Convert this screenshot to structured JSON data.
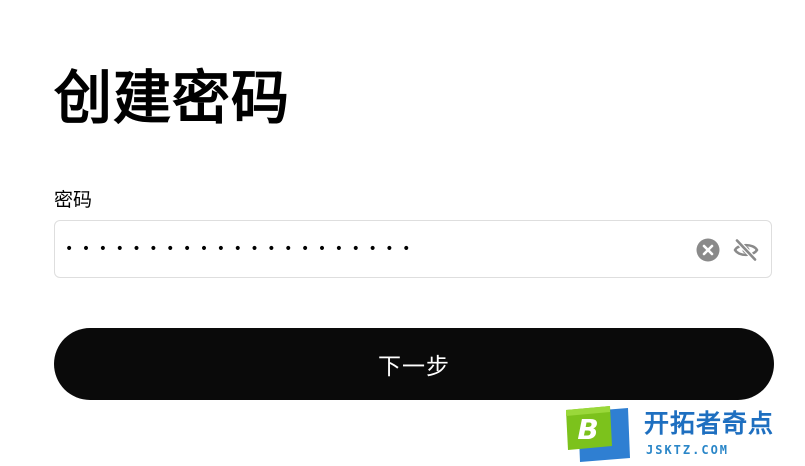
{
  "page": {
    "title": "创建密码"
  },
  "password_field": {
    "label": "密码",
    "masked_value": "•••••••••••••••••••••",
    "clear_icon": "clear-circle-icon",
    "visibility_icon": "eye-off-icon"
  },
  "actions": {
    "next_label": "下一步"
  },
  "watermark": {
    "name": "开拓者奇点",
    "domain": "JSKTZ.COM",
    "logo_letter": "B"
  },
  "colors": {
    "button_bg": "#0a0a0a",
    "button_text": "#ffffff",
    "input_border": "#dedede",
    "icon_gray": "#8a8a8a",
    "watermark_blue": "#1e6fc0",
    "watermark_green": "#7cc21c"
  }
}
